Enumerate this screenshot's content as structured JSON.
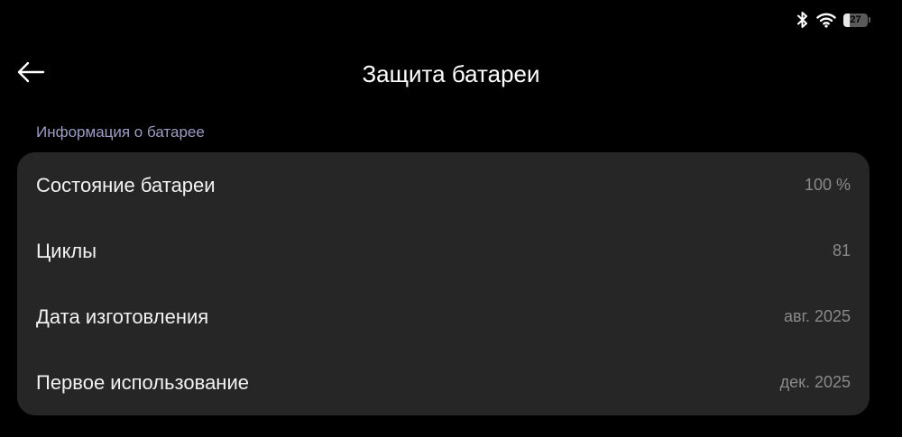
{
  "status_bar": {
    "icons": [
      "bluetooth-icon",
      "wifi-icon",
      "battery-icon"
    ],
    "battery_level": "27",
    "battery_fraction": 0.27
  },
  "header": {
    "back_icon": "arrow-left-icon",
    "title": "Защита батареи"
  },
  "section": {
    "label": "Информация о батарее",
    "rows": [
      {
        "label": "Состояние батареи",
        "value": "100 %"
      },
      {
        "label": "Циклы",
        "value": "81"
      },
      {
        "label": "Дата изготовления",
        "value": "авг. 2025"
      },
      {
        "label": "Первое использование",
        "value": "дек. 2025"
      }
    ]
  },
  "colors": {
    "background": "#000000",
    "card": "#262626",
    "section_label": "#9c9cc4",
    "value_text": "#8a8a8a"
  }
}
